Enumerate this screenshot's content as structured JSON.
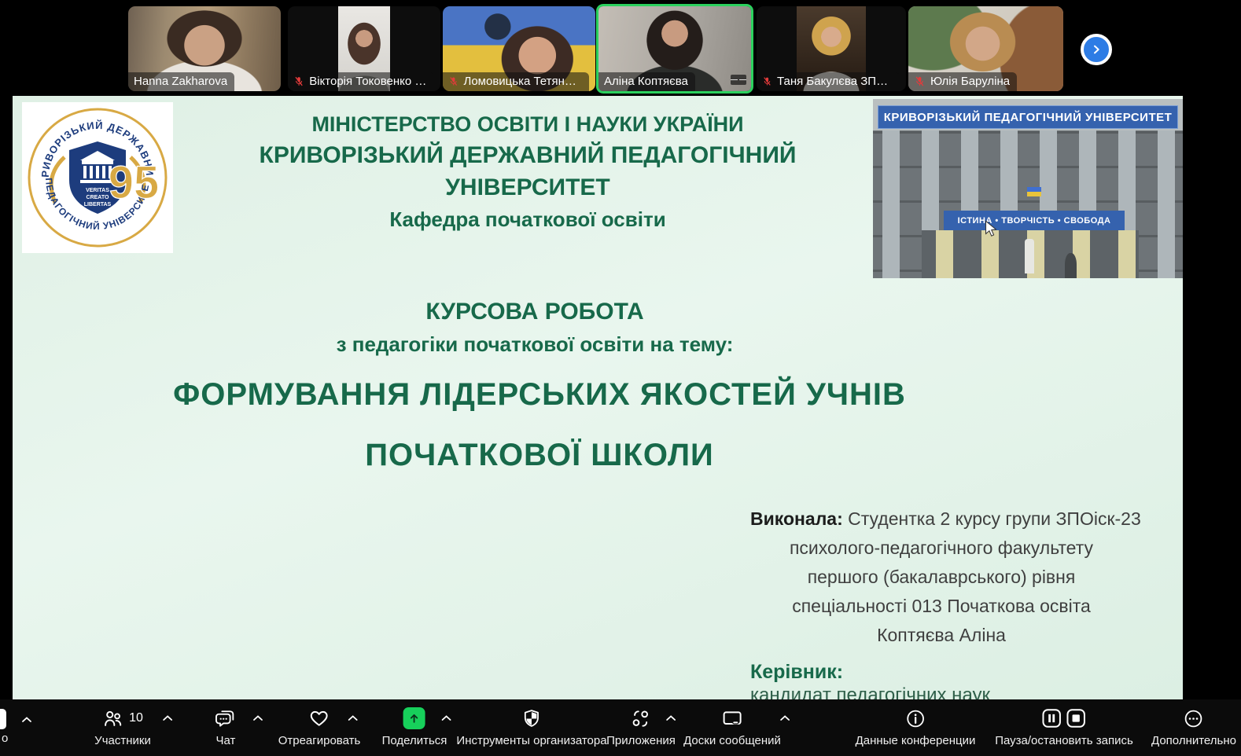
{
  "meeting": {
    "participants_count": "10",
    "participants": [
      {
        "name": "Hanna Zakharova",
        "muted": false
      },
      {
        "name": "Вікторія Токовенко З…",
        "muted": true
      },
      {
        "name": "Ломовицька Тетяна О…",
        "muted": true
      },
      {
        "name": "Аліна Коптяєва",
        "muted": false,
        "active": true
      },
      {
        "name": "Таня Бакулєва ЗПОіск…",
        "muted": true
      },
      {
        "name": "Юлія Баруліна",
        "muted": true
      }
    ]
  },
  "slide": {
    "header": {
      "line1": "МІНІСТЕРСТВО ОСВІТИ І НАУКИ УКРАЇНИ",
      "line2": "КРИВОРІЗЬКИЙ ДЕРЖАВНИЙ ПЕДАГОГІЧНИЙ УНІВЕРСИТЕТ",
      "line3": "Кафедра початкової освіти"
    },
    "logo": {
      "arc_top": "КРИВОРІЗЬКИЙ ДЕРЖАВНИЙ",
      "arc_bottom": "ПЕДАГОГІЧНИЙ УНІВЕРСИТЕТ",
      "motto1": "VERITAS",
      "motto2": "CREATO",
      "motto3": "LIBERTAS",
      "anniversary": "95"
    },
    "building": {
      "banner_top": "КРИВОРІЗЬКИЙ  ПЕДАГОГІЧНИЙ  УНІВЕРСИТЕТ",
      "banner_slogan": "ІСТИНА • ТВОРЧІСТЬ • СВОБОДА"
    },
    "work": {
      "type": "КУРСОВА РОБОТА",
      "subject": "з педагогіки початкової освіти на тему:",
      "title_line1": "ФОРМУВАННЯ ЛІДЕРСЬКИХ ЯКОСТЕЙ УЧНІВ",
      "title_line2": "ПОЧАТКОВОЇ ШКОЛИ"
    },
    "author": {
      "label": "Виконала:",
      "line1_rest": "Студентка 2 курсу групи ЗПОіск-23",
      "line2": "психолого-педагогічного факультету",
      "line3": "першого (бакалаврського) рівня",
      "line4": "спеціальності 013 Початкова  освіта",
      "line5": "Коптяєва Аліна",
      "supervisor_label": "Керівник:",
      "supervisor_line": "кандидат педагогічних наук"
    }
  },
  "toolbar": {
    "partial_label": "о",
    "items": [
      {
        "label": "Участники",
        "count": "10"
      },
      {
        "label": "Чат"
      },
      {
        "label": "Отреагировать"
      },
      {
        "label": "Поделиться"
      },
      {
        "label": "Инструменты организатора"
      },
      {
        "label": "Приложения"
      },
      {
        "label": "Доски сообщений"
      },
      {
        "label": "Данные конференции"
      },
      {
        "label": "Пауза/остановить запись"
      },
      {
        "label": "Дополнительно"
      }
    ]
  },
  "colors": {
    "active_speaker_border": "#2bd15e",
    "share_button_green": "#17d05b",
    "mute_red": "#e23b3b",
    "slide_green_text": "#17694a",
    "banner_blue": "#3562ae",
    "next_button_blue": "#2d7ce5"
  }
}
